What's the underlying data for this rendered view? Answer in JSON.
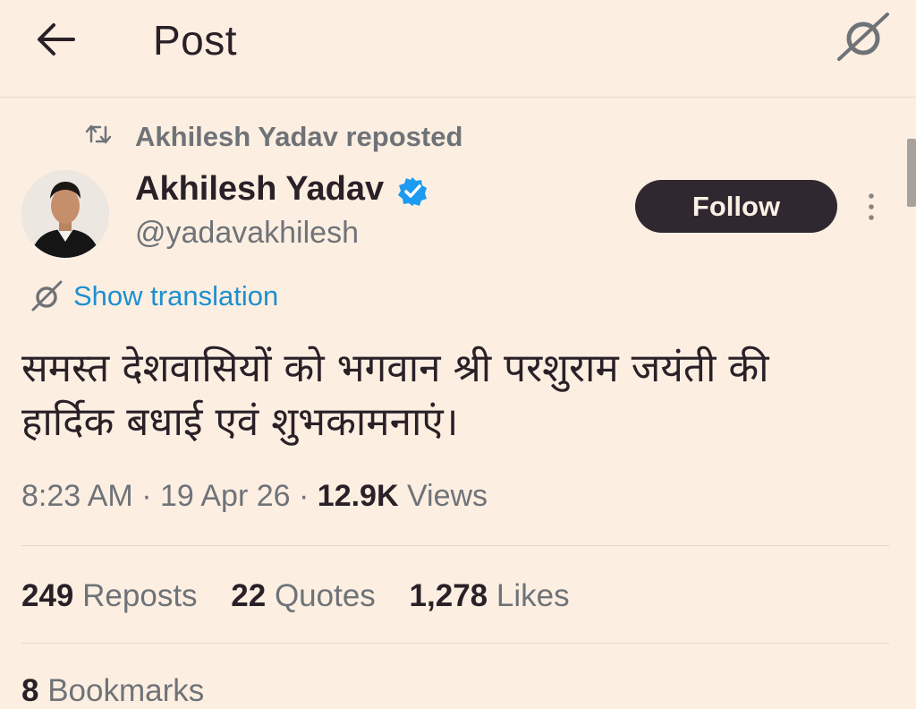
{
  "header": {
    "title": "Post",
    "back_icon": "arrow-left-icon",
    "translate_icon": "translate-icon"
  },
  "repost": {
    "icon": "repost-icon",
    "text": "Akhilesh Yadav reposted"
  },
  "author": {
    "name": "Akhilesh Yadav",
    "handle": "@yadavakhilesh",
    "verified": true,
    "verified_color": "#1d9bf0"
  },
  "follow_button": {
    "label": "Follow"
  },
  "show_translation": "Show translation",
  "post_text_line1": "समस्त देशवासियों को भगवान श्री परशुराम जयंती की",
  "post_text_line2": "हार्दिक बधाई एवं शुभकामनाएं।",
  "meta": {
    "time": "8:23 AM",
    "separator": "·",
    "date": "19 Apr 26",
    "views_count": "12.9K",
    "views_label": "Views"
  },
  "stats": {
    "reposts_count": "249",
    "reposts_label": "Reposts",
    "quotes_count": "22",
    "quotes_label": "Quotes",
    "likes_count": "1,278",
    "likes_label": "Likes",
    "bookmarks_count": "8",
    "bookmarks_label": "Bookmarks"
  },
  "colors": {
    "background": "#fcefe2",
    "text_primary": "#2a2027",
    "text_secondary": "#6f7378",
    "link": "#1d8fd0",
    "button_bg": "#2f2830"
  }
}
